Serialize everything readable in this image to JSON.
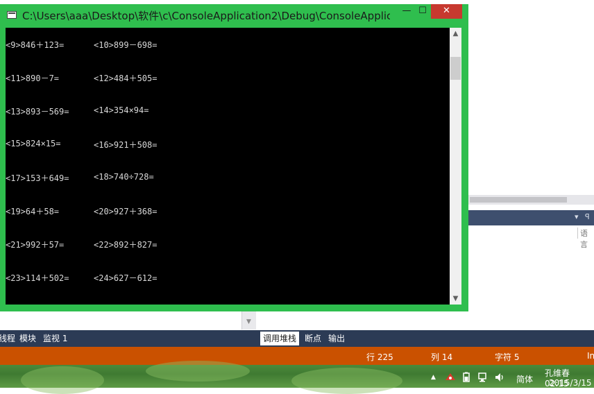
{
  "window": {
    "title": "C:\\Users\\aaa\\Desktop\\软件\\c\\ConsoleApplication2\\Debug\\ConsoleApplic...",
    "minimize_glyph": "—",
    "maximize_glyph": "☐",
    "close_glyph": "✕"
  },
  "console_lines": [
    {
      "left": "<9>846＋123=",
      "right": "<10>899－698="
    },
    {
      "left": "<11>890－7=",
      "right": "<12>484＋505="
    },
    {
      "left": "<13>893－569=",
      "right": "<14>354×94="
    },
    {
      "left": "<15>824×15=",
      "right": "<16>921＋508="
    },
    {
      "left": "<17>153＋649=",
      "right": "<18>740÷728="
    },
    {
      "left": "<19>64＋58=",
      "right": "<20>927＋368="
    },
    {
      "left": "<21>992＋57=",
      "right": "<22>892＋827="
    },
    {
      "left": "<23>114＋502=",
      "right": "<24>627－612="
    }
  ],
  "scrollbar": {
    "up": "▲",
    "down": "▼"
  },
  "vs": {
    "panel_ctrl_dropdown": "▾",
    "panel_ctrl_pin": "ꟼ",
    "lang_label": "语言",
    "dropdown_arrow": "▼",
    "tabs_left": [
      "线程",
      "模块",
      "监视 1"
    ],
    "tabs_right": [
      "调用堆栈",
      "断点",
      "输出"
    ],
    "status": {
      "row": "行 225",
      "col": "列 14",
      "char": "字符 5",
      "mode": "In"
    }
  },
  "taskbar": {
    "up_arrow": "▲",
    "ime": "简体",
    "user": "孔维春 02:15",
    "date": "2015/3/15"
  },
  "colors": {
    "window_frame": "#2fbe4e",
    "close_button": "#c7392f",
    "status_bar": "#ca5100",
    "tab_bar": "#2c3b55"
  }
}
